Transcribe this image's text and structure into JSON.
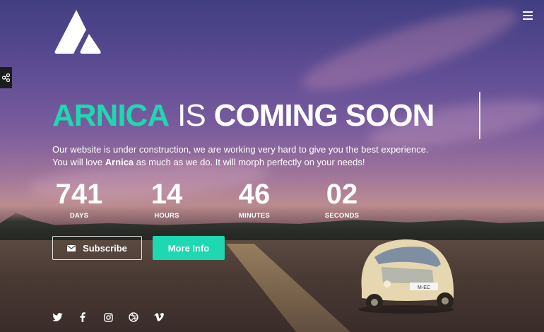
{
  "brand": {
    "logo_icon": "arnica-triangle-logo"
  },
  "colors": {
    "accent": "#1ed8b1",
    "text": "#ffffff",
    "share_tab": "#1d1d1d"
  },
  "header": {
    "menu_icon": "hamburger-menu-icon"
  },
  "share": {
    "icon": "share-icon"
  },
  "headline": {
    "brand": "ARNICA",
    "is": "IS",
    "coming_soon": "COMING SOON"
  },
  "description": {
    "line1": "Our website is under construction, we are working very hard to give you the best experience.",
    "line2_before": "You will love ",
    "line2_bold": "Arnica",
    "line2_after": " as much as we do. It will morph perfectly on your needs!"
  },
  "countdown": [
    {
      "value": "741",
      "label": "DAYS"
    },
    {
      "value": "14",
      "label": "HOURS"
    },
    {
      "value": "46",
      "label": "MINUTES"
    },
    {
      "value": "02",
      "label": "SECONDS"
    }
  ],
  "buttons": {
    "subscribe": "Subscribe",
    "subscribe_icon": "envelope-icon",
    "more_info": "More Info"
  },
  "socials": [
    "twitter-icon",
    "facebook-icon",
    "instagram-icon",
    "dribbble-icon",
    "vimeo-icon"
  ]
}
